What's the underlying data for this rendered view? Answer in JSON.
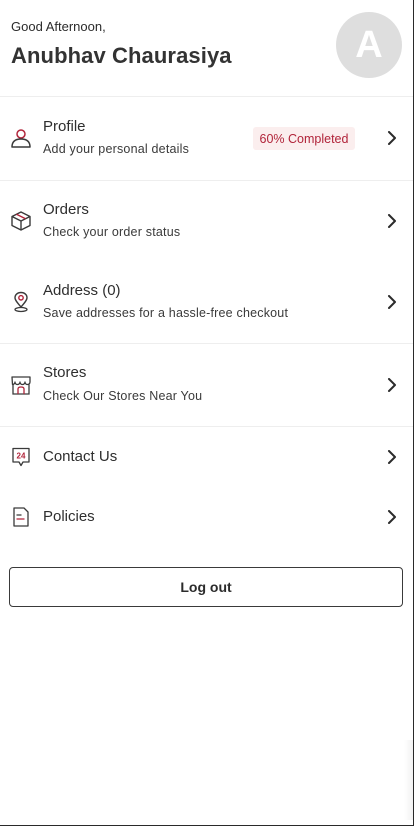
{
  "header": {
    "greeting": "Good Afternoon,",
    "user_name": "Anubhav Chaurasiya",
    "avatar_initial": "A"
  },
  "menu": [
    {
      "icon": "user-icon",
      "title": "Profile",
      "subtitle": "Add your personal details",
      "badge": "60% Completed"
    },
    {
      "icon": "package-box-icon",
      "title": "Orders",
      "subtitle": "Check your order status"
    },
    {
      "icon": "location-pin-icon",
      "title": "Address (0)",
      "subtitle": "Save addresses for a hassle-free checkout"
    },
    {
      "icon": "store-icon",
      "title": "Stores",
      "subtitle": "Check Our Stores Near You"
    },
    {
      "icon": "support-24-icon",
      "title": "Contact Us"
    },
    {
      "icon": "document-icon",
      "title": "Policies"
    }
  ],
  "logout_label": "Log out",
  "colors": {
    "accent": "#b1243a",
    "badge_bg": "#fbeeee",
    "avatar_bg": "#dedede",
    "text": "#2b2b2b"
  }
}
